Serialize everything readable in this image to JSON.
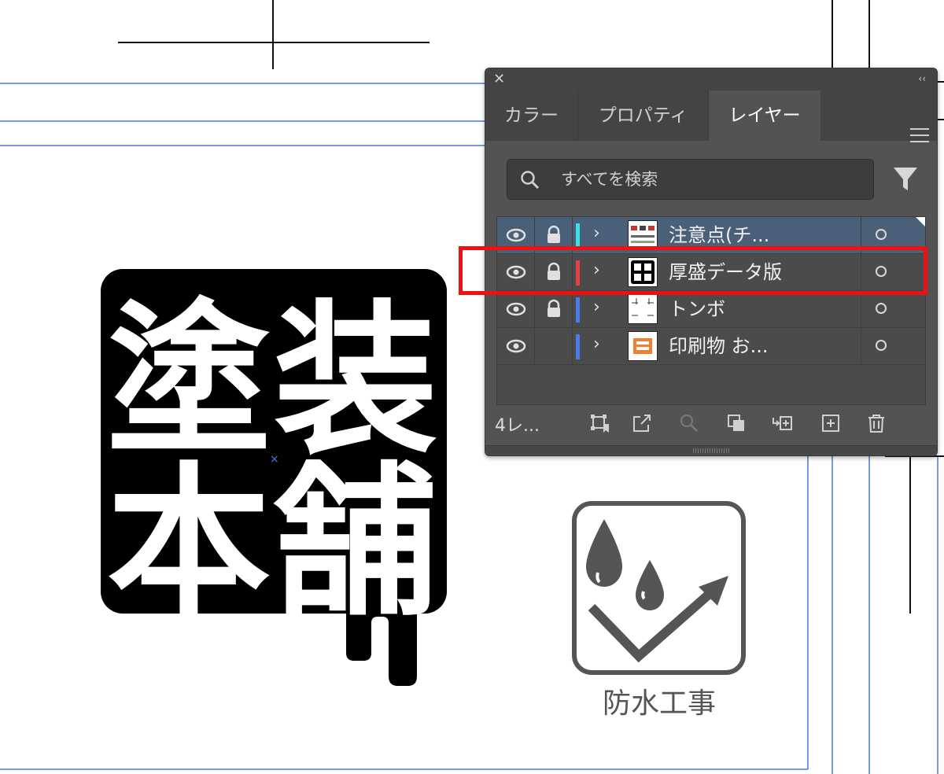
{
  "logo": {
    "line1_left": "塗",
    "line1_right": "装",
    "line2_left": "本",
    "line2_right": "舗"
  },
  "icon_label": "防水工事",
  "panel": {
    "tabs": [
      "カラー",
      "プロパティ",
      "レイヤー"
    ],
    "active_tab": "レイヤー",
    "search_placeholder": "すべてを検索",
    "layers": [
      {
        "name": "注意点(チ...",
        "color": "#3ee0e8",
        "visible": true,
        "locked": true,
        "selected": true
      },
      {
        "name": "厚盛データ版",
        "color": "#e84040",
        "visible": true,
        "locked": true,
        "selected": false
      },
      {
        "name": "トンボ",
        "color": "#4a7cf0",
        "visible": true,
        "locked": true,
        "selected": false
      },
      {
        "name": "印刷物 お...",
        "color": "#4a7cf0",
        "visible": true,
        "locked": false,
        "selected": false
      }
    ],
    "layer_count": "4レ..."
  },
  "colors": {
    "highlight": "#ee1111",
    "guide": "#4a78e0",
    "panel_bg": "#535353"
  }
}
